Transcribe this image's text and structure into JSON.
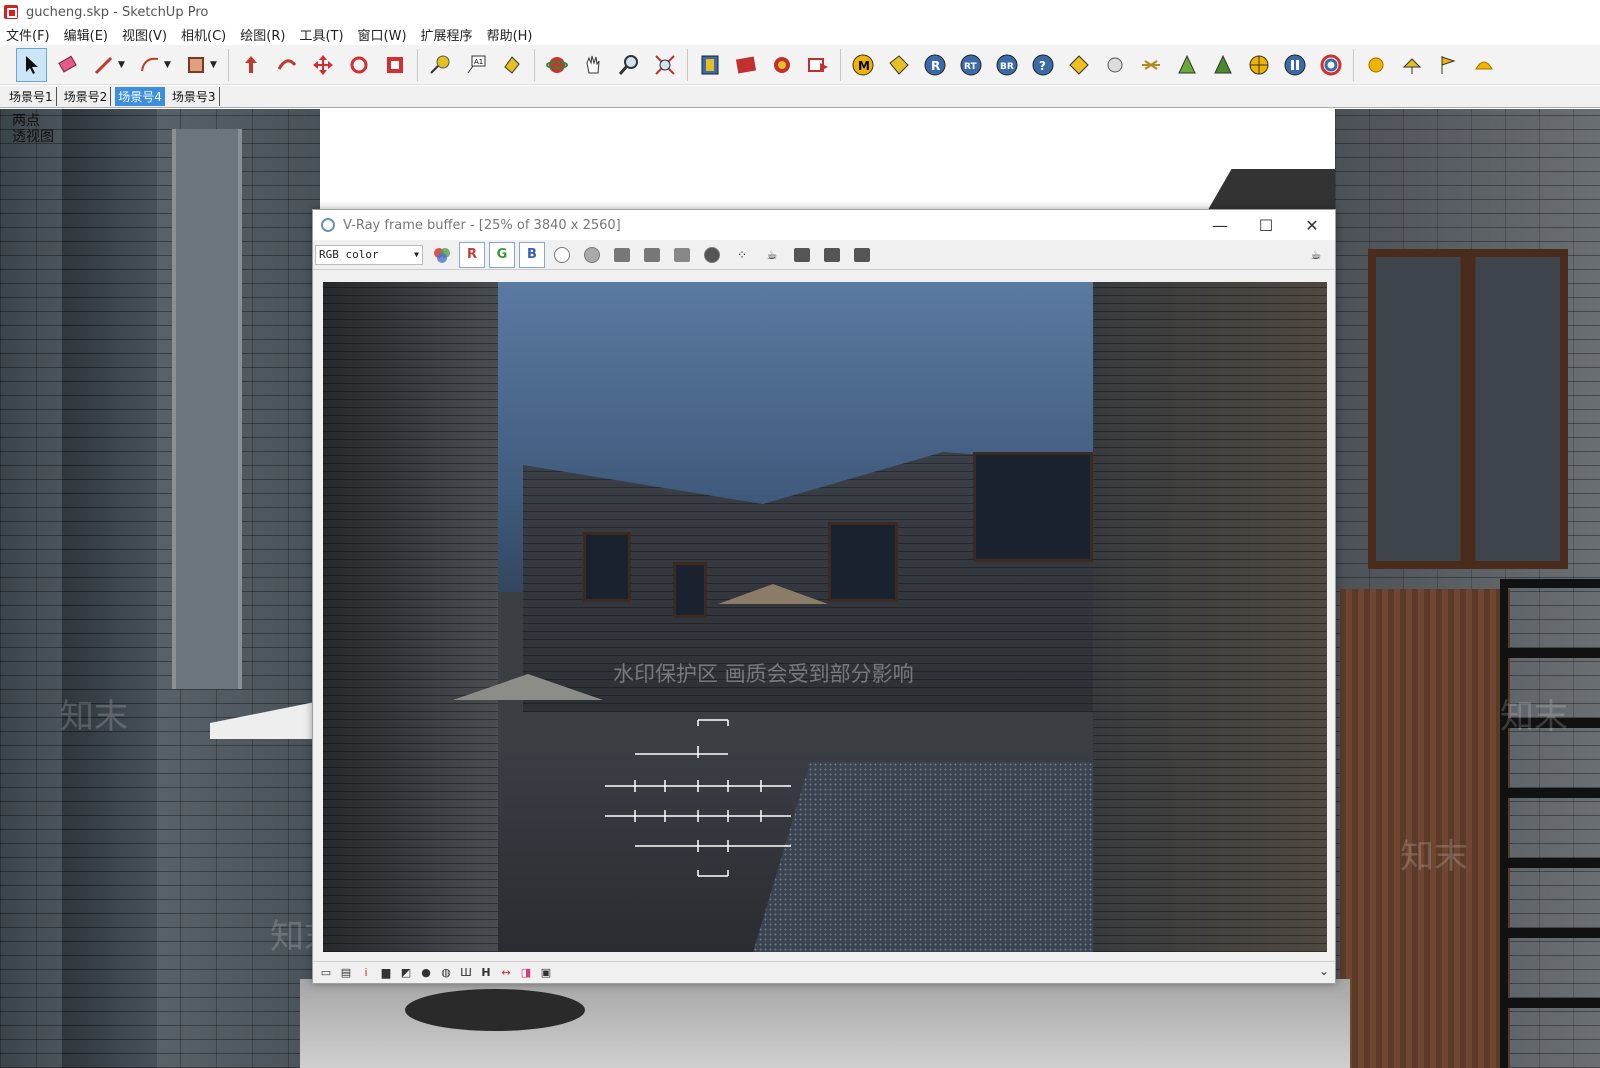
{
  "window": {
    "title": "gucheng.skp - SketchUp Pro"
  },
  "menu": [
    "文件(F)",
    "编辑(E)",
    "视图(V)",
    "相机(C)",
    "绘图(R)",
    "工具(T)",
    "窗口(W)",
    "扩展程序",
    "帮助(H)"
  ],
  "toolbar": {
    "tools": [
      "select-icon",
      "eraser-icon",
      "pencil-icon",
      "arc-icon",
      "rectangle-icon",
      "push-pull-icon",
      "follow-me-icon",
      "move-icon",
      "rotate-icon",
      "scale-icon",
      "tape-measure-icon",
      "text-icon",
      "paint-bucket-icon",
      "orbit-icon",
      "pan-icon",
      "zoom-icon",
      "zoom-extents-icon",
      "warehouse-icon",
      "extension-icon",
      "layout-icon",
      "send-icon",
      "vray-material-icon",
      "vray-light-icon",
      "render-icon",
      "render-rt-icon",
      "batch-render-icon",
      "help-icon",
      "tag-icon",
      "sphere-light-icon",
      "mesh-light-icon",
      "proxy-icon",
      "fur-icon",
      "plane-icon",
      "infinite-plane-icon",
      "pause-icon",
      "colour-icon",
      "sun-icon",
      "dome-icon",
      "flag-icon",
      "bun-icon"
    ]
  },
  "scenes": {
    "tabs": [
      "场景号1",
      "场景号2",
      "场景号4",
      "场景号3"
    ],
    "active_index": 2
  },
  "viewport": {
    "view_label_1": "两点",
    "view_label_2": "透视图",
    "watermark": "知末"
  },
  "vfb": {
    "title": "V-Ray frame buffer - [25% of 3840 x 2560]",
    "channel": "RGB color",
    "channel_buttons": [
      "R",
      "G",
      "B"
    ],
    "render_watermark": "水印保护区   画质会受到部分影响"
  },
  "colors": {
    "accent": "#3c8fe0",
    "toolbar_bg": "#f3f3f3"
  }
}
